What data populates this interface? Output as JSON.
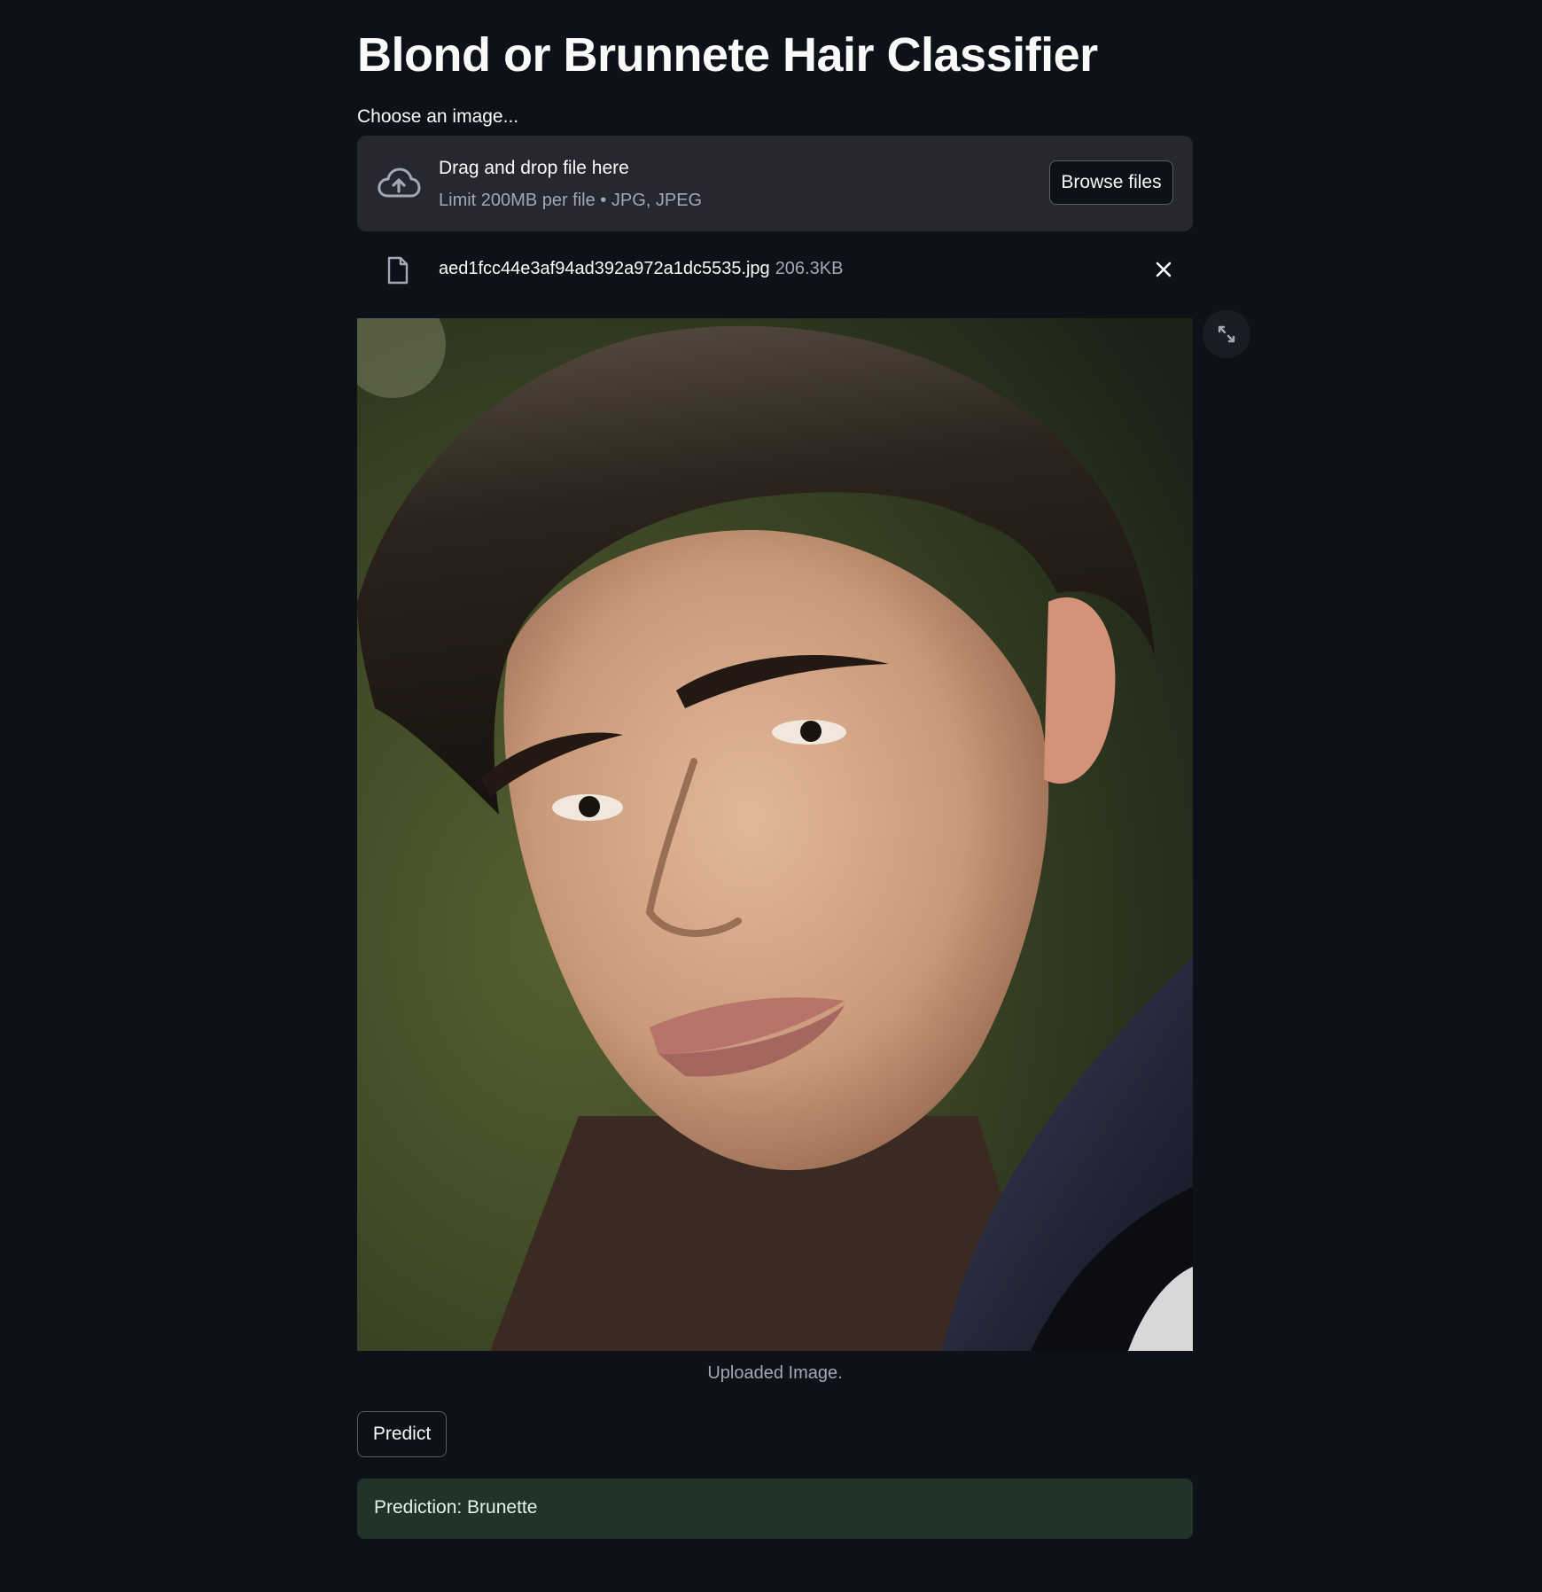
{
  "page": {
    "title": "Blond or Brunnete Hair Classifier"
  },
  "uploader": {
    "label": "Choose an image...",
    "drop_text": "Drag and drop file here",
    "limit_text": "Limit 200MB per file • JPG, JPEG",
    "browse_label": "Browse files",
    "icon": "cloud-upload-icon"
  },
  "file": {
    "name": "aed1fcc44e3af94ad392a972a1dc5535.jpg",
    "size": "206.3KB",
    "icon": "file-icon",
    "close_icon": "close-icon"
  },
  "image": {
    "caption": "Uploaded Image.",
    "expand_icon": "fullscreen-icon"
  },
  "actions": {
    "predict_label": "Predict"
  },
  "result": {
    "text": "Prediction: Brunette"
  },
  "colors": {
    "background": "#0e1117",
    "dropzone": "#262730",
    "success_bg": "#21342a",
    "muted_text": "#a3a8b8"
  }
}
